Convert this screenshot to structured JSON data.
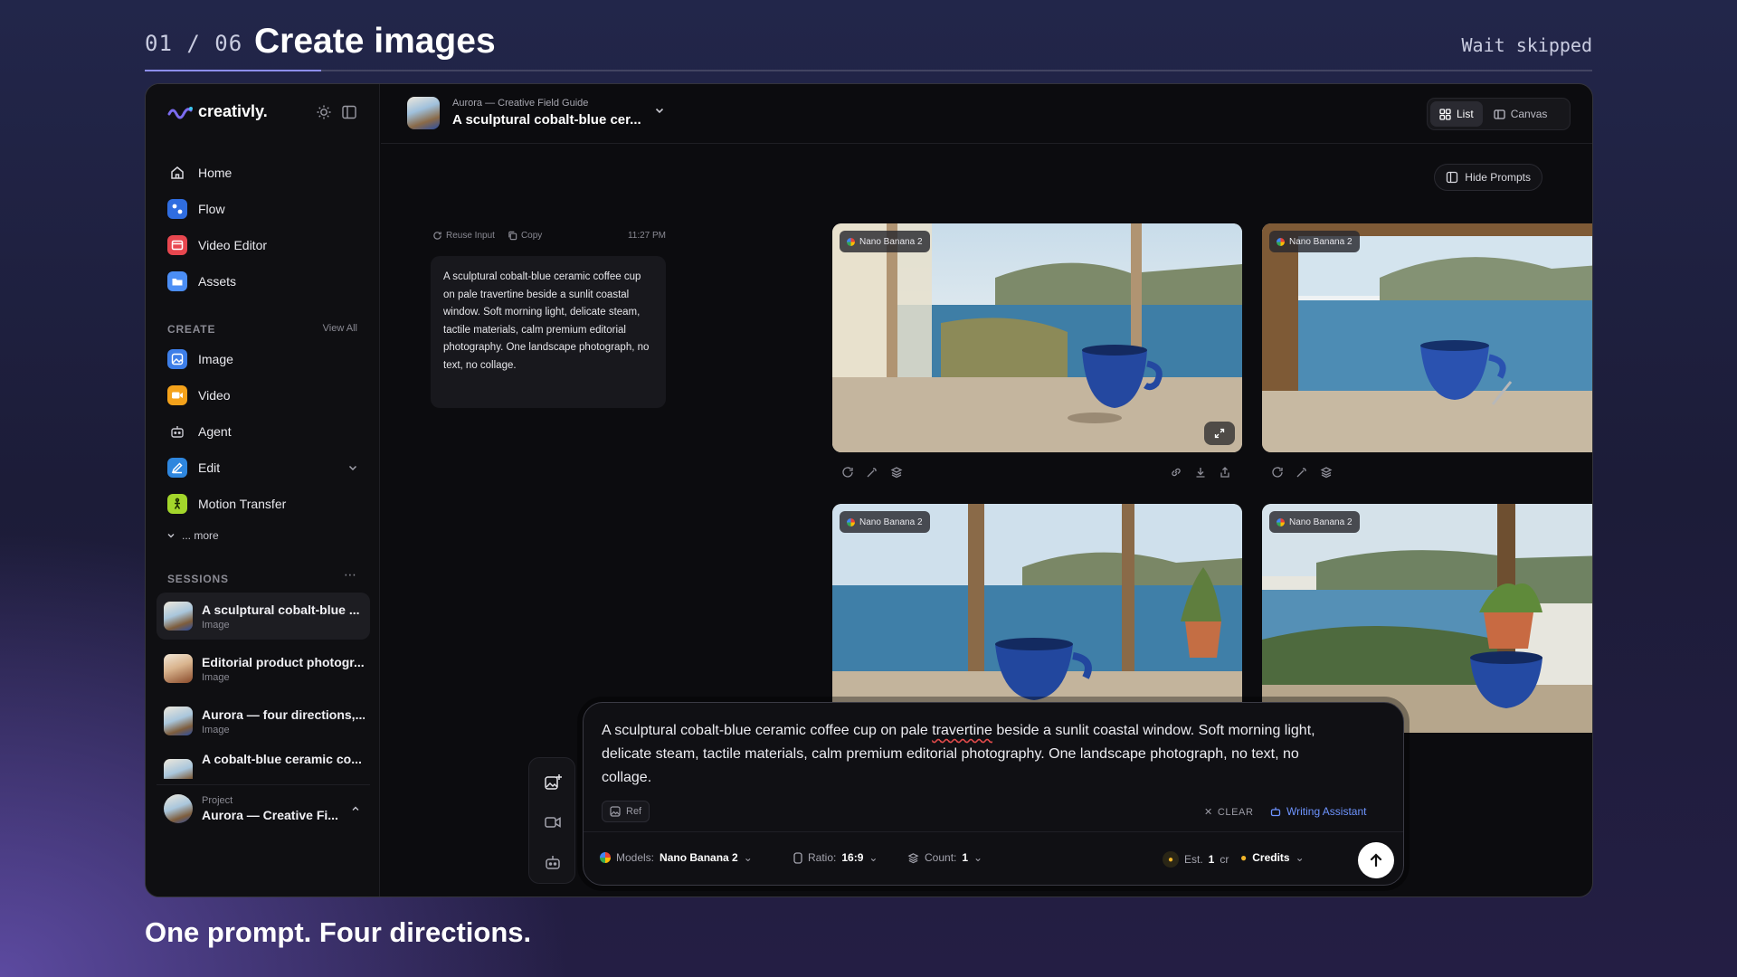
{
  "top": {
    "step": "01 / 06",
    "title": "Create images",
    "wait_label": "Wait skipped",
    "progress": 0.122
  },
  "caption": "One prompt. Four directions.",
  "sidebar": {
    "logo_text": "creativly.",
    "nav": [
      {
        "label": "Home",
        "icon": "home-icon"
      },
      {
        "label": "Flow",
        "icon": "flow-icon"
      },
      {
        "label": "Video Editor",
        "icon": "video-editor-icon"
      },
      {
        "label": "Assets",
        "icon": "assets-icon"
      }
    ],
    "create_heading": "CREATE",
    "view_all": "View All",
    "create_items": [
      {
        "label": "Image",
        "icon": "image-icon"
      },
      {
        "label": "Video",
        "icon": "video-icon"
      },
      {
        "label": "Agent",
        "icon": "agent-icon"
      },
      {
        "label": "Edit",
        "icon": "edit-icon"
      },
      {
        "label": "Motion Transfer",
        "icon": "motion-transfer-icon"
      }
    ],
    "more": "... more",
    "sessions_heading": "SESSIONS",
    "sessions": [
      {
        "title": "A sculptural cobalt-blue ...",
        "type": "Image"
      },
      {
        "title": "Editorial product photogr...",
        "type": "Image"
      },
      {
        "title": "Aurora — four directions,...",
        "type": "Image"
      },
      {
        "title": "A cobalt-blue ceramic co...",
        "type": ""
      }
    ],
    "project": {
      "label": "Project",
      "name": "Aurora — Creative Fi..."
    }
  },
  "header": {
    "subtitle": "Aurora — Creative Field Guide",
    "title": "A sculptural cobalt-blue cer...",
    "view_list": "List",
    "view_canvas": "Canvas",
    "hide_prompts": "Hide Prompts"
  },
  "prompt": {
    "reuse": "Reuse Input",
    "copy": "Copy",
    "time": "11:27 PM",
    "text": "A sculptural cobalt-blue ceramic coffee cup on pale travertine beside a sunlit coastal window. Soft morning light, delicate steam, tactile materials, calm premium editorial photography. One landscape photograph, no text, no collage."
  },
  "images": [
    {
      "model": "Nano Banana 2"
    },
    {
      "model": "Nano Banana 2"
    },
    {
      "model": "Nano Banana 2"
    },
    {
      "model": "Nano Banana 2"
    }
  ],
  "composer": {
    "text_a": "A sculptural cobalt-blue ceramic coffee cup on pale ",
    "text_b": "travertine",
    "text_c": " beside a sunlit coastal window. Soft morning light, delicate steam, tactile materials, calm premium editorial photography. One landscape photograph, no text, no collage.",
    "ref": "Ref",
    "clear": "CLEAR",
    "writing_assistant": "Writing Assistant",
    "models_label": "Models:",
    "model_value": "Nano Banana 2",
    "ratio_label": "Ratio:",
    "ratio_value": "16:9",
    "count_label": "Count:",
    "count_value": "1",
    "est_label": "Est.",
    "est_value": "1",
    "est_unit": "cr",
    "credits": "Credits"
  },
  "colors": {
    "accent": "#6e94ff",
    "flow": "#2f6de0",
    "video_editor": "#e8474f",
    "assets": "#4b8ef5",
    "image": "#3d7ee8",
    "video": "#f4a21b",
    "edit": "#2e86de",
    "motion": "#a3d62b"
  }
}
